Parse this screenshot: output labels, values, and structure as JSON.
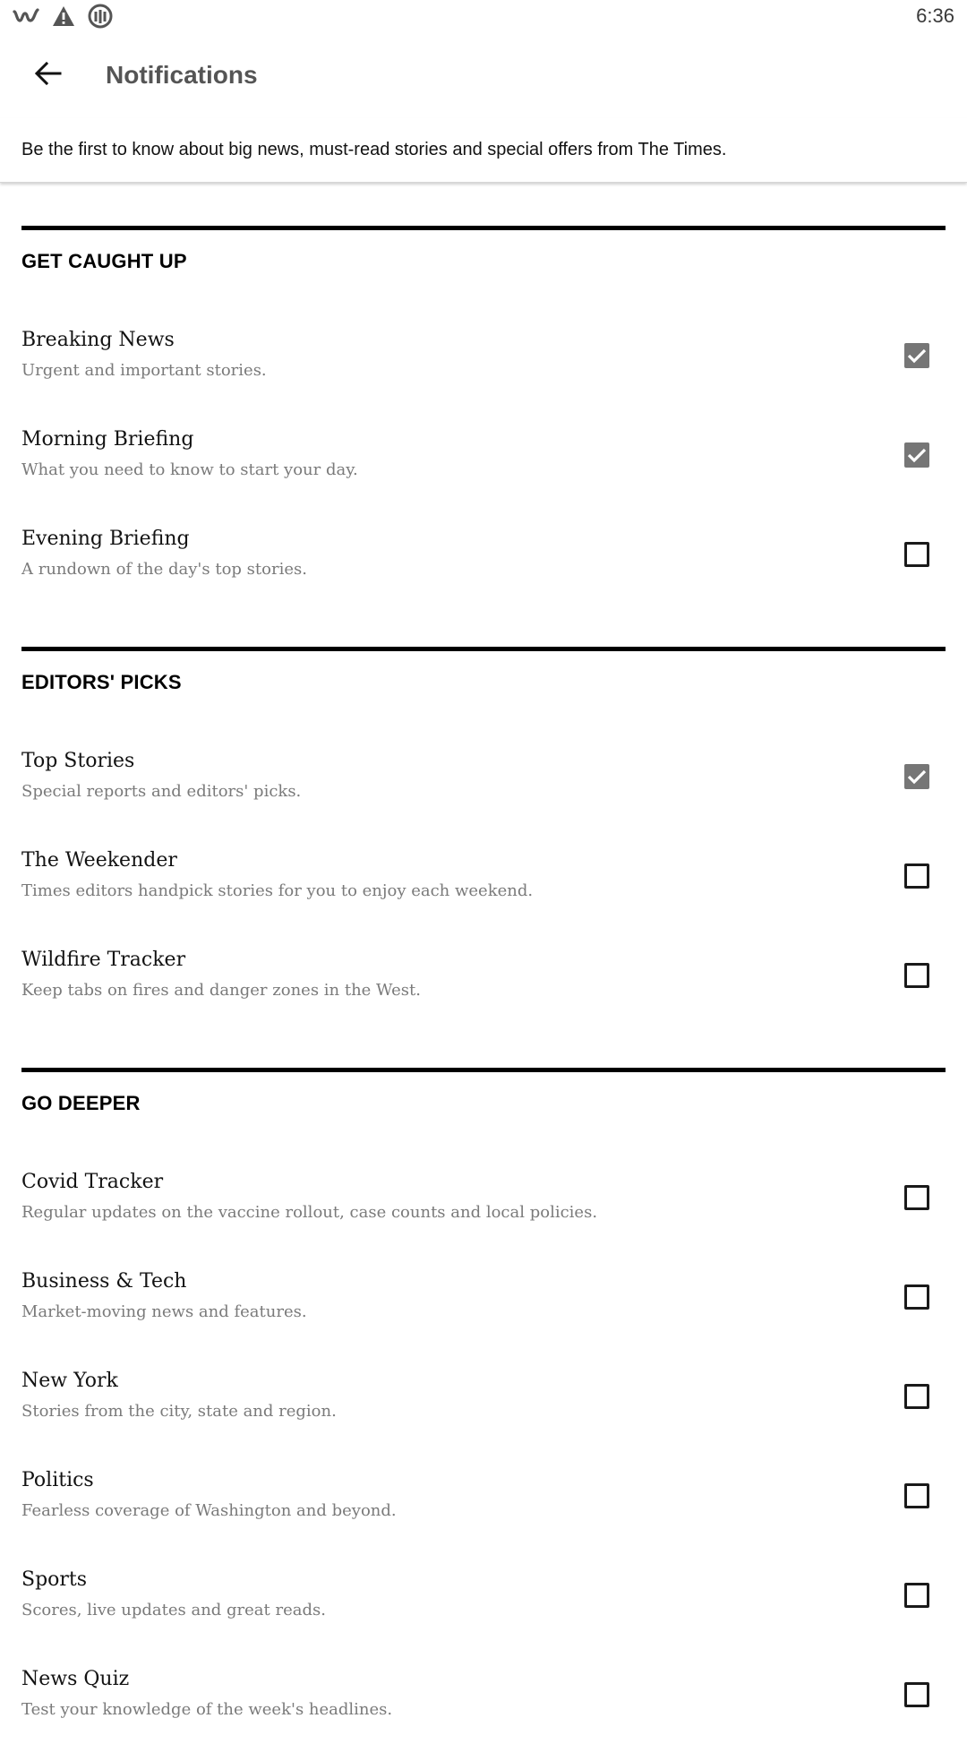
{
  "status_bar": {
    "time": "6:36",
    "icons": [
      "w-app-icon",
      "warning-icon",
      "g-app-icon"
    ]
  },
  "header": {
    "title": "Notifications",
    "back_icon": "arrow-left-icon"
  },
  "intro_text": "Be the first to know about big news, must-read stories and special offers from The Times.",
  "colors": {
    "checked_fill": "#767676",
    "rule": "#000000",
    "subtitle": "#7a7a7a"
  },
  "sections": [
    {
      "title": "GET CAUGHT UP",
      "items": [
        {
          "title": "Breaking News",
          "subtitle": "Urgent and important stories.",
          "checked": true
        },
        {
          "title": "Morning Briefing",
          "subtitle": "What you need to know to start your day.",
          "checked": true
        },
        {
          "title": "Evening Briefing",
          "subtitle": "A rundown of the day's top stories.",
          "checked": false
        }
      ]
    },
    {
      "title": "EDITORS' PICKS",
      "items": [
        {
          "title": "Top Stories",
          "subtitle": "Special reports and editors' picks.",
          "checked": true
        },
        {
          "title": "The Weekender",
          "subtitle": "Times editors handpick stories for you to enjoy each weekend.",
          "checked": false
        },
        {
          "title": "Wildfire Tracker",
          "subtitle": "Keep tabs on fires and danger zones in the West.",
          "checked": false
        }
      ]
    },
    {
      "title": "GO DEEPER",
      "items": [
        {
          "title": "Covid Tracker",
          "subtitle": "Regular updates on the vaccine rollout, case counts and local policies.",
          "checked": false
        },
        {
          "title": "Business & Tech",
          "subtitle": "Market-moving news and features.",
          "checked": false
        },
        {
          "title": "New York",
          "subtitle": "Stories from the city, state and region.",
          "checked": false
        },
        {
          "title": "Politics",
          "subtitle": "Fearless coverage of Washington and beyond.",
          "checked": false
        },
        {
          "title": "Sports",
          "subtitle": "Scores, live updates and great reads.",
          "checked": false
        },
        {
          "title": "News Quiz",
          "subtitle": "Test your knowledge of the week's headlines.",
          "checked": false
        }
      ]
    }
  ]
}
